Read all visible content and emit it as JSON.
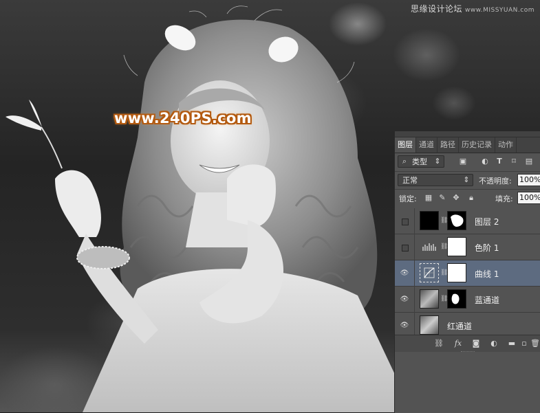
{
  "watermark_top": {
    "text": "思缘设计论坛",
    "sub": "www.MISSYUAN.com"
  },
  "watermark_main": "www.240PS.com",
  "layers_panel": {
    "tabs": [
      {
        "label": "图层",
        "active": true
      },
      {
        "label": "通道",
        "active": false
      },
      {
        "label": "路径",
        "active": false
      },
      {
        "label": "历史记录",
        "active": false
      },
      {
        "label": "动作",
        "active": false
      }
    ],
    "filter": {
      "icon": "search-icon",
      "kind_label": "类型",
      "dropdown_icon": "updown-icon",
      "filter_icons": [
        "image-filter-icon",
        "adjustment-filter-icon",
        "type-filter-icon",
        "shape-filter-icon",
        "smart-object-filter-icon"
      ]
    },
    "blend_mode": "正常",
    "opacity_label": "不透明度:",
    "opacity_value": "100%",
    "lock_label": "锁定:",
    "lock_icons": [
      "lock-transparent-icon",
      "lock-brush-icon",
      "lock-move-icon",
      "lock-all-icon"
    ],
    "fill_label": "填充:",
    "fill_value": "100%",
    "layers": [
      {
        "name": "图层 2",
        "visible": false,
        "selected": false,
        "thumb": "black",
        "mask": "black-with-white-shape"
      },
      {
        "name": "色阶 1",
        "visible": false,
        "selected": false,
        "thumb": "levels-icon",
        "mask": "white"
      },
      {
        "name": "曲线 1",
        "visible": true,
        "selected": true,
        "thumb": "curves-icon",
        "mask": "white"
      },
      {
        "name": "蓝通道",
        "visible": true,
        "selected": false,
        "thumb": "photo",
        "mask": "black-with-white-shape"
      },
      {
        "name": "红通道",
        "visible": true,
        "selected": false,
        "thumb": "photo",
        "mask": ""
      }
    ],
    "footer_icons": [
      "link-layers-icon",
      "fx-icon",
      "add-mask-icon",
      "new-adjustment-icon",
      "new-group-icon",
      "new-layer-icon",
      "delete-layer-icon"
    ],
    "fx_label": "fx"
  },
  "colors": {
    "panel_bg": "#535353",
    "selected_layer": "#5d6b80",
    "watermark_outline": "#b35a10"
  }
}
